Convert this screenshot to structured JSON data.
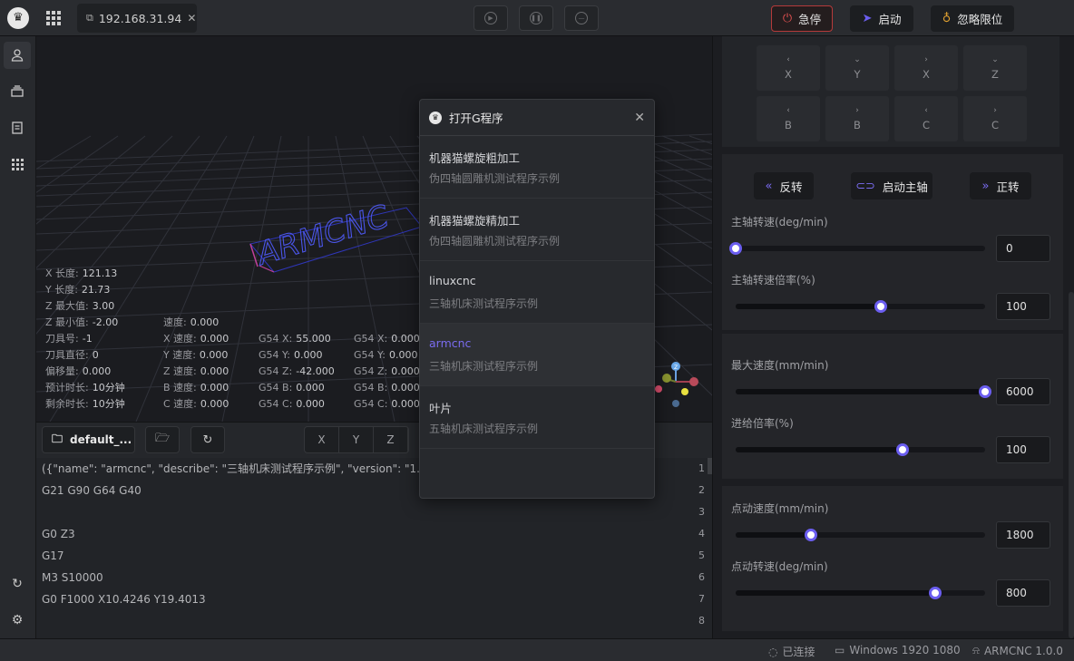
{
  "header": {
    "tab_label": "192.168.31.94",
    "estop_label": "急停",
    "start_label": "启动",
    "ignore_limit_label": "忽略限位"
  },
  "viewport": {
    "overlay_text": "ARMCNC",
    "stats": [
      {
        "label": "X 长度:",
        "value": "121.13"
      },
      {
        "label": "Y 长度:",
        "value": "21.73"
      },
      {
        "label": "Z 最大值:",
        "value": "3.00"
      },
      {
        "label": "Z 最小值:",
        "value": "-2.00"
      },
      {
        "label": "刀具号:",
        "value": "-1"
      },
      {
        "label": "刀具直径:",
        "value": "0"
      },
      {
        "label": "偏移量:",
        "value": "0.000"
      },
      {
        "label": "预计时长:",
        "value": "10分钟"
      },
      {
        "label": "剩余时长:",
        "value": "10分钟"
      }
    ],
    "speeds": [
      {
        "label": "速度:",
        "value": "0.000"
      },
      {
        "label": "X 速度:",
        "value": "0.000"
      },
      {
        "label": "Y 速度:",
        "value": "0.000"
      },
      {
        "label": "Z 速度:",
        "value": "0.000"
      },
      {
        "label": "B 速度:",
        "value": "0.000"
      },
      {
        "label": "C 速度:",
        "value": "0.000"
      }
    ],
    "g54_a": [
      {
        "label": "G54 X:",
        "value": "55.000"
      },
      {
        "label": "G54 Y:",
        "value": "0.000"
      },
      {
        "label": "G54 Z:",
        "value": "-42.000"
      },
      {
        "label": "G54 B:",
        "value": "0.000"
      },
      {
        "label": "G54 C:",
        "value": "0.000"
      }
    ],
    "g54_b": [
      {
        "label": "G54 X:",
        "value": "0.000"
      },
      {
        "label": "G54 Y:",
        "value": "0.000"
      },
      {
        "label": "G54 Z:",
        "value": "0.000"
      },
      {
        "label": "G54 B:",
        "value": "0.000"
      },
      {
        "label": "G54 C:",
        "value": "0.000"
      }
    ]
  },
  "code_toolbar": {
    "file_name": "default_...",
    "axes": [
      "X",
      "Y",
      "Z"
    ]
  },
  "code": [
    {
      "n": "1",
      "text": "({\"name\": \"armcnc\", \"describe\": \"三轴机床测试程序示例\", \"version\": \"1.0.0\"})"
    },
    {
      "n": "2",
      "text": "G21 G90 G64 G40"
    },
    {
      "n": "3",
      "text": ""
    },
    {
      "n": "4",
      "text": "G0 Z3"
    },
    {
      "n": "5",
      "text": "G17"
    },
    {
      "n": "6",
      "text": "M3 S10000"
    },
    {
      "n": "7",
      "text": "G0 F1000 X10.4246 Y19.4013"
    },
    {
      "n": "8",
      "text": ""
    }
  ],
  "jog": {
    "row1": [
      "X",
      "Y",
      "X",
      "Z"
    ],
    "row2": [
      "B",
      "B",
      "C",
      "C"
    ]
  },
  "spindle": {
    "reverse_label": "反转",
    "start_label": "启动主轴",
    "forward_label": "正转"
  },
  "sliders": [
    {
      "label": "主轴转速(deg/min)",
      "value": "0",
      "fraction": 0.0
    },
    {
      "label": "主轴转速倍率(%)",
      "value": "100",
      "fraction": 0.58
    },
    {
      "label": "最大速度(mm/min)",
      "value": "6000",
      "fraction": 1.0
    },
    {
      "label": "进给倍率(%)",
      "value": "100",
      "fraction": 0.67
    },
    {
      "label": "点动速度(mm/min)",
      "value": "1800",
      "fraction": 0.3
    },
    {
      "label": "点动转速(deg/min)",
      "value": "800",
      "fraction": 0.8
    }
  ],
  "statusbar": {
    "connection": "已连接",
    "display": "Windows 1920 1080",
    "version": "ARMCNC 1.0.0"
  },
  "modal": {
    "title": "打开G程序",
    "programs": [
      {
        "name": "机器猫螺旋粗加工",
        "describe": "伪四轴圆雕机测试程序示例"
      },
      {
        "name": "机器猫螺旋精加工",
        "describe": "伪四轴圆雕机测试程序示例"
      },
      {
        "name": "linuxcnc",
        "describe": "三轴机床测试程序示例"
      },
      {
        "name": "armcnc",
        "describe": "三轴机床测试程序示例"
      },
      {
        "name": "叶片",
        "describe": "五轴机床测试程序示例"
      }
    ],
    "selected_index": 3
  },
  "colors": {
    "accent": "#6b5ef0",
    "estop": "#e05050",
    "warn": "#e0a030"
  }
}
